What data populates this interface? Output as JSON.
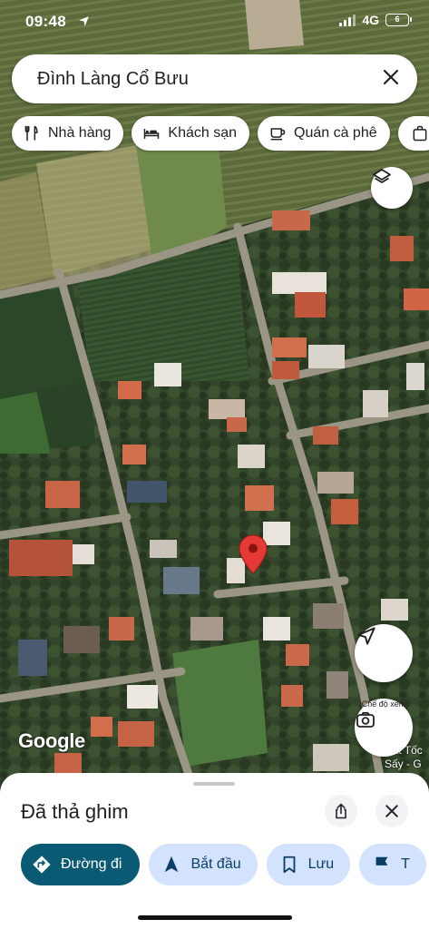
{
  "status_bar": {
    "time": "09:48",
    "network": "4G",
    "battery": "6"
  },
  "search": {
    "query": "Đình Làng Cổ Bưu"
  },
  "chips": [
    {
      "label": "Nhà hàng",
      "icon": "fork-knife-icon"
    },
    {
      "label": "Khách sạn",
      "icon": "bed-icon"
    },
    {
      "label": "Quán cà phê",
      "icon": "coffee-icon"
    },
    {
      "label": "",
      "icon": "shopping-bag-icon"
    }
  ],
  "map": {
    "watermark": "Google",
    "view_mode_label": "Chế độ xem",
    "place_label_line1": "Cát Tốc",
    "place_label_line2": "Sấy - G",
    "pin_color": "#e53935"
  },
  "sheet": {
    "title": "Đã thả ghim",
    "actions": [
      {
        "label": "Đường đi",
        "icon": "directions-icon"
      },
      {
        "label": "Bắt đầu",
        "icon": "navigation-arrow-icon"
      },
      {
        "label": "Lưu",
        "icon": "bookmark-icon"
      },
      {
        "label": "T",
        "icon": "flag-icon"
      }
    ]
  }
}
